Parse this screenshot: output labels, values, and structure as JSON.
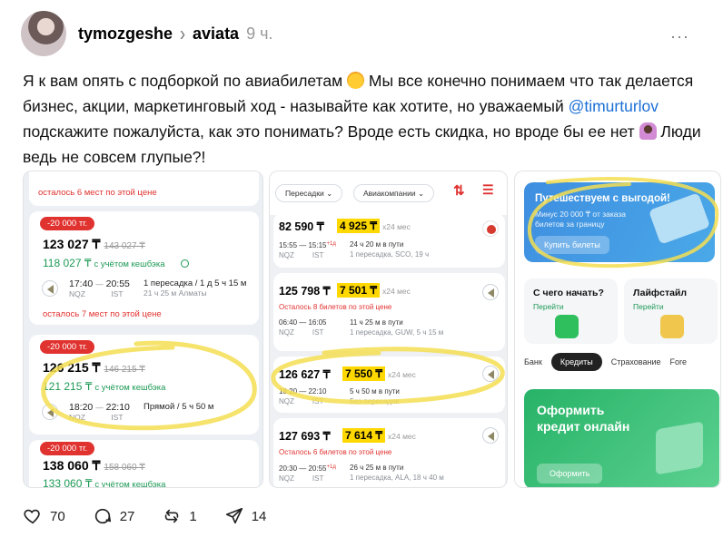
{
  "post": {
    "username": "tymozgeshe",
    "separator": "›",
    "community": "aviata",
    "time": "9 ч.",
    "more": "···",
    "text1": "Я к вам опять с подборкой по авиабилетам",
    "text2": "Мы все конечно понимаем что так делается бизнес, акции, маркетинговый ход - называйте как хотите, но уважаемый ",
    "mention": "@timurturlov",
    "text3": " подскажите пожалуйста, как это понимать? Вроде есть скидка, но вроде бы ее нет",
    "text4": "  Люди ведь не совсем глупые?!",
    "emoji1": "sweat-smile-emoji",
    "emoji2": "shrug-emoji"
  },
  "shot1": {
    "top_note": "осталось 6 мест по этой цене",
    "badge": "-20 000 тг.",
    "o1": {
      "price": "123 027 ₸",
      "old": "143 027 ₸",
      "cash": "118 027 ₸",
      "cash_note": "с учётом кешбэка",
      "dep": "17:40",
      "arr": "20:55",
      "from": "NQZ",
      "to": "IST",
      "info": "1 пересадка / 1 д 5 ч 15 м",
      "info2": "21 ч 25 м Алматы",
      "warn": "осталось 7 мест по этой цене"
    },
    "o2": {
      "price": "126 215 ₸",
      "old": "146 215 ₸",
      "cash": "121 215 ₸",
      "cash_note": "с учётом кешбэка",
      "dep": "18:20",
      "arr": "22:10",
      "from": "NQZ",
      "to": "IST",
      "info": "Прямой / 5 ч 50 м"
    },
    "o3": {
      "price": "138 060 ₸",
      "old": "158 060 ₸",
      "cash": "133 060 ₸",
      "cash_note": "с учётом кешбэка"
    }
  },
  "shot2": {
    "filters": [
      "Пересадки",
      "Авиакомпании"
    ],
    "sort_icon": "sort-arrows-icon",
    "rows": [
      {
        "price": "82 590 ₸",
        "monthly": "4 925 ₸",
        "mo": "x24 мес",
        "dep": "15:55",
        "arr": "15:15",
        "plus": "+1д",
        "from": "NQZ",
        "to": "IST",
        "dur": "24 ч 20 м в пути",
        "stops": "1 пересадка, SCO, 19 ч",
        "warn": ""
      },
      {
        "price": "125 798 ₸",
        "monthly": "7 501 ₸",
        "mo": "x24 мес",
        "dep": "06:40",
        "arr": "16:05",
        "plus": "",
        "from": "NQZ",
        "to": "IST",
        "dur": "11 ч 25 м в пути",
        "stops": "1 пересадка, GUW, 5 ч 15 м",
        "warn": "Осталось 8 билетов по этой цене"
      },
      {
        "price": "126 627 ₸",
        "monthly": "7 550 ₸",
        "mo": "x24 мес",
        "dep": "18:20",
        "arr": "22:10",
        "plus": "",
        "from": "NQZ",
        "to": "IST",
        "dur": "5 ч 50 м в пути",
        "stops": "Без пересадок",
        "warn": ""
      },
      {
        "price": "127 693 ₸",
        "monthly": "7 614 ₸",
        "mo": "x24 мес",
        "dep": "20:30",
        "arr": "20:55",
        "plus": "+1д",
        "from": "NQZ",
        "to": "IST",
        "dur": "26 ч 25 м в пути",
        "stops": "1 пересадка, ALA, 18 ч 40 м",
        "warn": "Осталось 6 билетов по этой цене"
      }
    ]
  },
  "shot3": {
    "banner_title": "Путешествуем с выгодой!",
    "banner_text": "Минус 20 000 ₸ от заказа билетов за границу",
    "banner_btn": "Купить билеты",
    "m1_title": "С чего начать?",
    "m1_link": "Перейти",
    "m2_title": "Лайфстайл",
    "m2_link": "Перейти",
    "tabs": [
      "Банк",
      "Кредиты",
      "Страхование",
      "Fore"
    ],
    "credit_title": "Оформить кредит онлайн",
    "credit_btn": "Оформить"
  },
  "actions": {
    "likes": "70",
    "comments": "27",
    "reposts": "1",
    "shares": "14"
  }
}
